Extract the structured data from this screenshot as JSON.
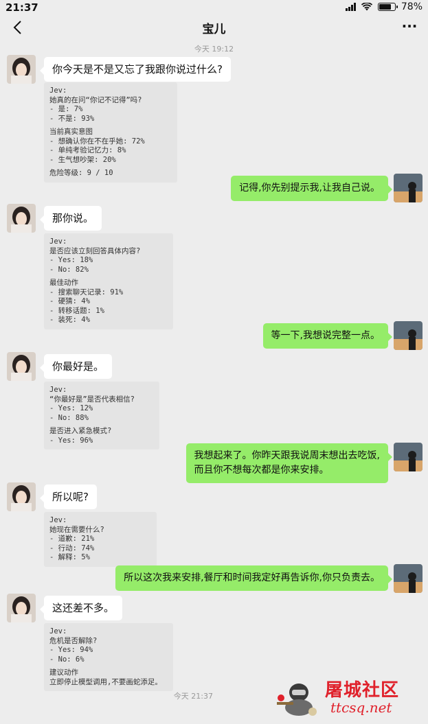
{
  "status_bar": {
    "time": "21:37",
    "battery": "78%",
    "battery_level": 0.78
  },
  "nav": {
    "title": "宝儿",
    "more_label": "···"
  },
  "timestamps": {
    "first": "今天 19:12",
    "last": "今天 21:37"
  },
  "messages": [
    {
      "side": "in",
      "text": "你今天是不是又忘了我跟你说过什么?"
    },
    {
      "side": "jev",
      "lines": [
        "Jev:",
        "她真的在问“你记不记得”吗?",
        "- 是: 7%",
        "- 不是: 93%",
        "",
        "当前真实意图",
        "- 想确认你在不在乎她: 72%",
        "- 单纯考验记忆力: 8%",
        "- 生气想吵架: 20%",
        "",
        "危险等级: 9 / 10"
      ]
    },
    {
      "side": "out",
      "text": "记得,你先别提示我,让我自己说。"
    },
    {
      "side": "in",
      "text": "那你说。"
    },
    {
      "side": "jev",
      "lines": [
        "Jev:",
        "是否应该立刻回答具体内容?",
        "- Yes: 18%",
        "- No: 82%",
        "",
        "最佳动作",
        "- 搜索聊天记录: 91%",
        "- 硬猜: 4%",
        "- 转移话题: 1%",
        "- 装死: 4%"
      ]
    },
    {
      "side": "out",
      "text": "等一下,我想说完整一点。"
    },
    {
      "side": "in",
      "text": "你最好是。"
    },
    {
      "side": "jev",
      "lines": [
        "Jev:",
        "“你最好是”是否代表相信?",
        "- Yes: 12%",
        "- No: 88%",
        "",
        "是否进入紧急模式?",
        "- Yes: 96%"
      ]
    },
    {
      "side": "out",
      "text": "我想起来了。你昨天跟我说周末想出去吃饭,",
      "text2": "而且你不想每次都是你来安排。"
    },
    {
      "side": "in",
      "text": "所以呢?"
    },
    {
      "side": "jev",
      "lines": [
        "Jev:",
        "她现在需要什么?",
        "- 道歉: 21%",
        "- 行动: 74%",
        "- 解释: 5%"
      ]
    },
    {
      "side": "out",
      "text": "所以这次我来安排,餐厅和时间我定好再告诉你,你只负责去。"
    },
    {
      "side": "in",
      "text": "这还差不多。"
    },
    {
      "side": "jev",
      "lines": [
        "Jev:",
        "危机是否解除?",
        "- Yes: 94%",
        "- No: 6%",
        "",
        "建议动作",
        "立即停止模型调用,不要画蛇添足。"
      ]
    }
  ],
  "watermark": {
    "title": "屠城社区",
    "subtitle": "ttcsq.net"
  },
  "colors": {
    "background": "#ededed",
    "bubble_out": "#95ec69",
    "bubble_in": "#ffffff",
    "jev_card": "#e4e4e4",
    "watermark": "#e0212b"
  }
}
